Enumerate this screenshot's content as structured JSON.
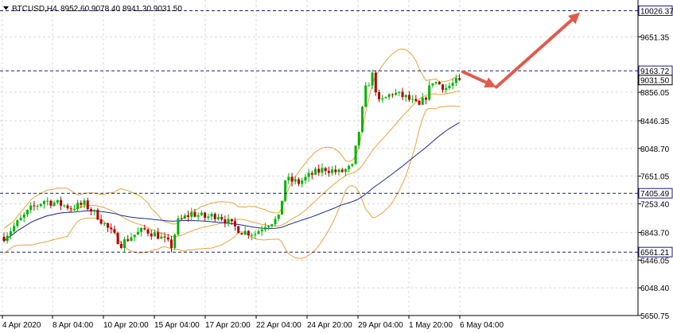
{
  "window": {
    "symbol_label": "BTCUSD,H4",
    "ohlc_label": "8952.60 9078.40 8941.30 9031.50"
  },
  "colors": {
    "background": "#ffffff",
    "grid": "#d8d8d8",
    "axis": "#000000",
    "candle_bull": "#00b400",
    "candle_bear": "#b40000",
    "bollinger": "#e8a33a",
    "ma": "#1a2aa0",
    "level_line": "#1a1a8c",
    "arrow": "#e05a50",
    "price_tag_bg": "#ffffff"
  },
  "chart_data": {
    "type": "candlestick",
    "title": "",
    "xlabel": "",
    "ylabel": "",
    "ylim": [
      5650.75,
      10180
    ],
    "x_ticks": [
      "4 Apr 2020",
      "8 Apr 04:00",
      "10 Apr 20:00",
      "15 Apr 04:00",
      "17 Apr 20:00",
      "22 Apr 04:00",
      "24 Apr 20:00",
      "29 Apr 04:00",
      "1 May 20:00",
      "6 May 04:00"
    ],
    "y_ticks": [
      "9651.35",
      "8856.05",
      "8446.35",
      "8048.70",
      "7651.05",
      "7253.40",
      "6843.70",
      "6446.05",
      "6048.40",
      "5650.75"
    ],
    "current_price": "9031.50",
    "levels": [
      {
        "label": "10026.37",
        "value": 10026.37
      },
      {
        "label": "9163.72",
        "value": 9163.72
      },
      {
        "label": "7405.49",
        "value": 7405.49
      },
      {
        "label": "6561.21",
        "value": 6561.21
      }
    ],
    "indicators": [
      "Bollinger Bands",
      "Moving Average"
    ],
    "arrows": [
      {
        "from": {
          "bar": 137,
          "price": 9150
        },
        "to": {
          "bar": 147,
          "price": 8930
        }
      },
      {
        "from": {
          "bar": 147,
          "price": 8930
        },
        "to": {
          "bar": 172,
          "price": 10000
        }
      }
    ],
    "waypoints": [
      [
        0,
        6780
      ],
      [
        4,
        6980
      ],
      [
        8,
        7180
      ],
      [
        12,
        7300
      ],
      [
        16,
        7260
      ],
      [
        20,
        7200
      ],
      [
        24,
        7250
      ],
      [
        28,
        7080
      ],
      [
        31,
        6900
      ],
      [
        35,
        6680
      ],
      [
        38,
        6790
      ],
      [
        42,
        6880
      ],
      [
        46,
        6800
      ],
      [
        50,
        6650
      ],
      [
        52,
        7000
      ],
      [
        56,
        7120
      ],
      [
        60,
        7060
      ],
      [
        64,
        7100
      ],
      [
        68,
        6950
      ],
      [
        71,
        6860
      ],
      [
        75,
        6830
      ],
      [
        78,
        6960
      ],
      [
        82,
        7040
      ],
      [
        84,
        7600
      ],
      [
        88,
        7560
      ],
      [
        92,
        7680
      ],
      [
        96,
        7760
      ],
      [
        100,
        7700
      ],
      [
        104,
        7780
      ],
      [
        106,
        8300
      ],
      [
        108,
        8900
      ],
      [
        110,
        9100
      ],
      [
        112,
        8700
      ],
      [
        116,
        8850
      ],
      [
        120,
        8780
      ],
      [
        124,
        8650
      ],
      [
        126,
        8800
      ],
      [
        128,
        9020
      ],
      [
        132,
        8920
      ],
      [
        136,
        9031.5
      ]
    ]
  }
}
